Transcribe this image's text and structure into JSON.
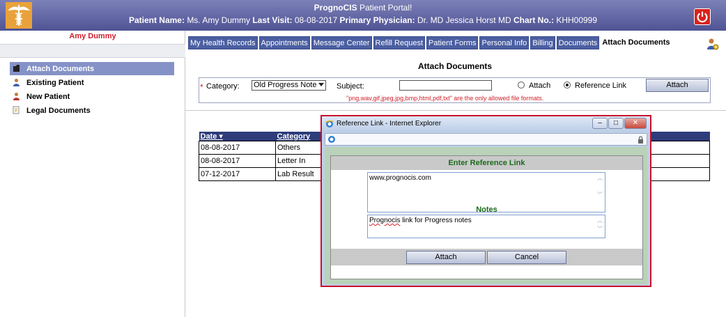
{
  "header": {
    "app_title_bold": "PrognoCIS",
    "app_title_rest": "Patient Portal!",
    "patient_name_label": "Patient Name:",
    "patient_name_value": "Ms. Amy Dummy",
    "last_visit_label": "Last Visit:",
    "last_visit_value": "08-08-2017",
    "physician_label": "Primary Physician:",
    "physician_value": "Dr. MD Jessica Horst MD",
    "chart_label": "Chart No.:",
    "chart_value": "KHH00999"
  },
  "sidebar": {
    "patient_name": "Amy Dummy",
    "items": [
      {
        "label": "Attach Documents",
        "icon": "folder-icon",
        "active": true
      },
      {
        "label": "Existing Patient",
        "icon": "user-icon",
        "active": false
      },
      {
        "label": "New Patient",
        "icon": "user-icon",
        "active": false
      },
      {
        "label": "Legal Documents",
        "icon": "document-icon",
        "active": false
      }
    ]
  },
  "tabs": [
    {
      "label": "My Health Records"
    },
    {
      "label": "Appointments"
    },
    {
      "label": "Message Center"
    },
    {
      "label": "Refill Request"
    },
    {
      "label": "Patient Forms"
    },
    {
      "label": "Personal Info"
    },
    {
      "label": "Billing"
    },
    {
      "label": "Documents"
    },
    {
      "label": "Attach Documents",
      "active": true
    }
  ],
  "form": {
    "title": "Attach Documents",
    "required_mark": "*",
    "category_label": "Category:",
    "category_value": "Old Progress Note",
    "subject_label": "Subject:",
    "subject_value": "",
    "radio_attach": "Attach",
    "radio_reference": "Reference Link",
    "selected_radio": "Reference Link",
    "attach_button": "Attach",
    "formats_note": "\"png,wav,gif,jpeg,jpg,bmp,html,pdf,txt\" are the only allowed file formats."
  },
  "table": {
    "headers": [
      "Date ▾",
      "Category"
    ],
    "rows": [
      [
        "08-08-2017",
        "Others"
      ],
      [
        "08-08-2017",
        "Letter In"
      ],
      [
        "07-12-2017",
        "Lab Result"
      ]
    ]
  },
  "popup": {
    "window_title": "Reference Link - Internet Explorer",
    "section_title": "Enter Reference Link",
    "link_value": "www.prognocis.com",
    "notes_label": "Notes",
    "notes_value_word": "Prognocis",
    "notes_value_rest": " link for Progress notes",
    "attach_button": "Attach",
    "cancel_button": "Cancel"
  },
  "colors": {
    "header_bg": "#5a5e9e",
    "tab_bg": "#4a5ea1",
    "active_menu_bg": "#8592c7",
    "table_header_bg": "#2e3c7a",
    "alert_red": "#d0202c",
    "popup_border": "#c8102e"
  }
}
